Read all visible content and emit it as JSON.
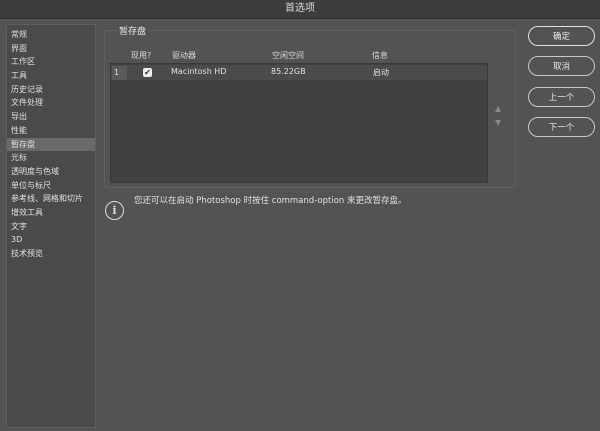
{
  "window": {
    "title": "首选项"
  },
  "sidebar": {
    "items": [
      {
        "label": "常规"
      },
      {
        "label": "界面"
      },
      {
        "label": "工作区"
      },
      {
        "label": "工具"
      },
      {
        "label": "历史记录"
      },
      {
        "label": "文件处理"
      },
      {
        "label": "导出"
      },
      {
        "label": "性能"
      },
      {
        "label": "暂存盘"
      },
      {
        "label": "光标"
      },
      {
        "label": "透明度与色域"
      },
      {
        "label": "单位与标尺"
      },
      {
        "label": "参考线、网格和切片"
      },
      {
        "label": "增效工具"
      },
      {
        "label": "文字"
      },
      {
        "label": "3D"
      },
      {
        "label": "技术预览"
      }
    ],
    "selected": "暂存盘"
  },
  "scratch": {
    "title": "暂存盘",
    "columns": [
      "现用?",
      "驱动器",
      "空闲空间",
      "信息"
    ],
    "rows": [
      {
        "index": "1",
        "active": true,
        "check": "✔",
        "drive": "Macintosh HD",
        "free": "85.22GB",
        "info": "启动"
      }
    ],
    "up_arrow": "▲",
    "down_arrow": "▼"
  },
  "info": {
    "icon": "i",
    "text": "您还可以在启动 Photoshop 时按住 command-option 来更改暂存盘。"
  },
  "buttons": {
    "ok": "确定",
    "cancel": "取消",
    "prev": "上一个",
    "next": "下一个"
  }
}
